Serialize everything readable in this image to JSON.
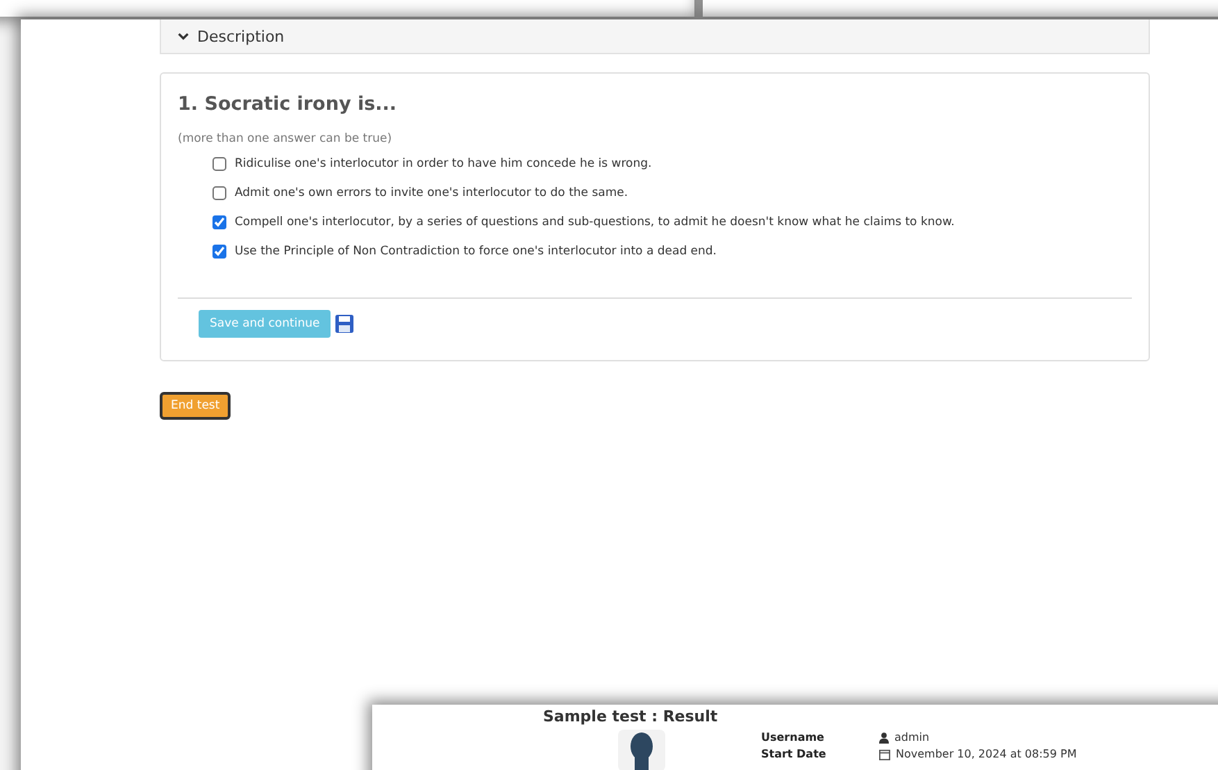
{
  "description": {
    "label": "Description"
  },
  "question": {
    "title": "1. Socratic irony is...",
    "hint": "(more than one answer can be true)",
    "answers": [
      {
        "text": "Ridiculise one's interlocutor in order to have him concede he is wrong.",
        "checked": false
      },
      {
        "text": "Admit one's own errors to invite one's interlocutor to do the same.",
        "checked": false
      },
      {
        "text": "Compell one's interlocutor, by a series of questions and sub-questions, to admit he doesn't know what he claims to know.",
        "checked": true
      },
      {
        "text": "Use the Principle of Non Contradiction to force one's interlocutor into a dead end.",
        "checked": true
      }
    ],
    "save_button": "Save and continue"
  },
  "end_button": "End test",
  "result_window": {
    "title": "Sample test : Result",
    "fields": [
      {
        "label": "Username",
        "value": "admin",
        "kind": "user"
      },
      {
        "label": "Start Date",
        "value": "November 10, 2024 at 08:59 PM",
        "kind": "date"
      }
    ]
  }
}
